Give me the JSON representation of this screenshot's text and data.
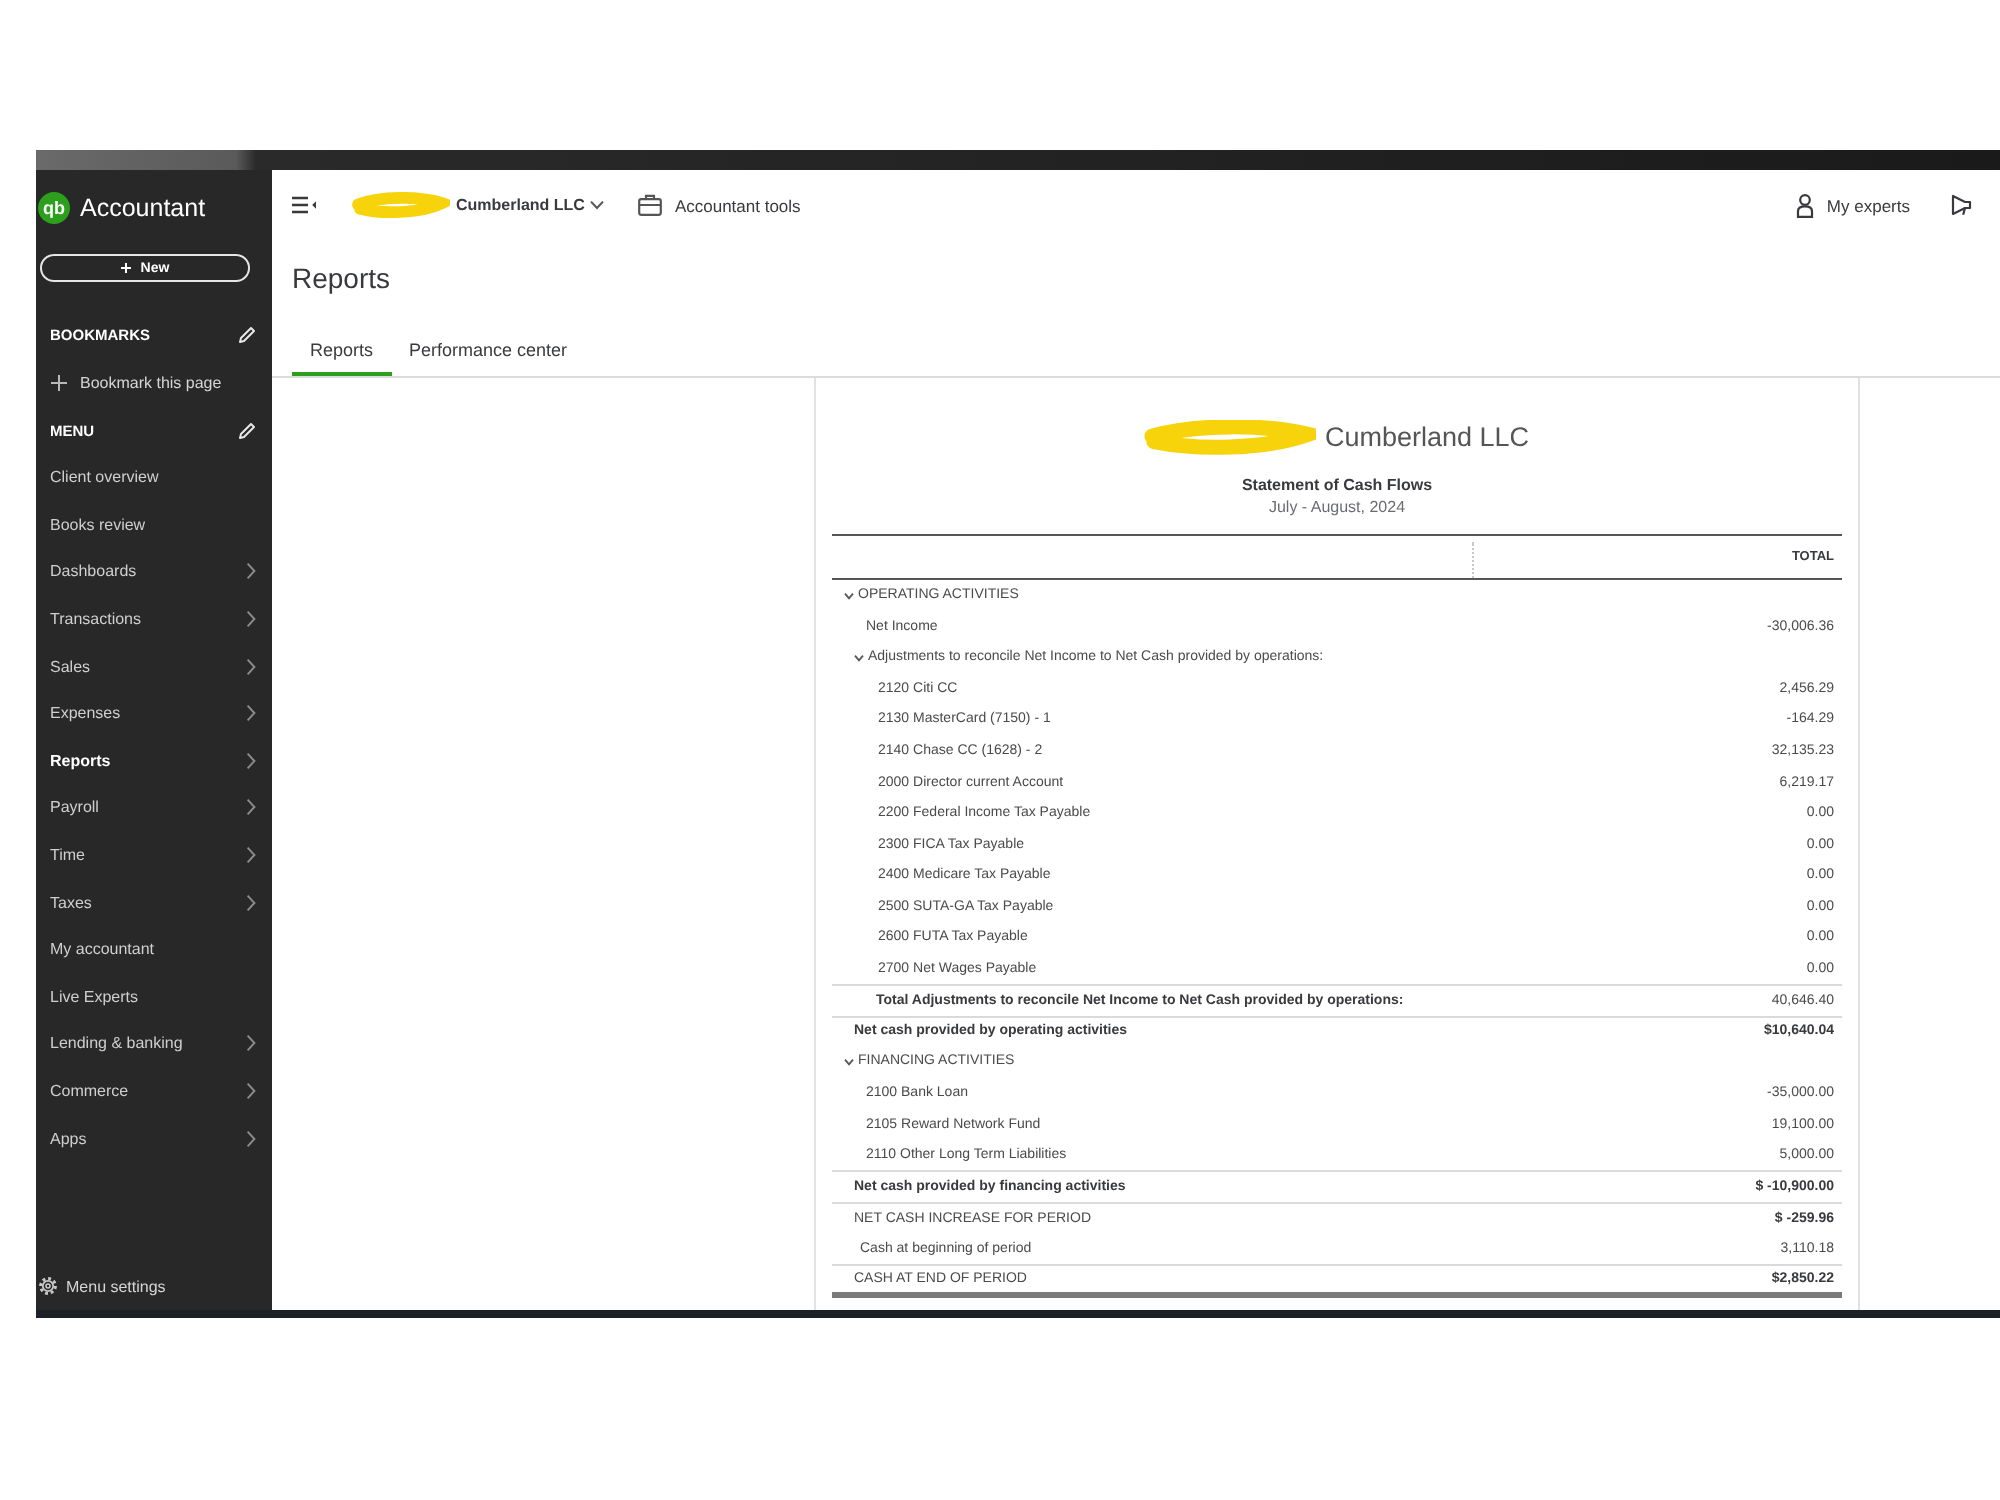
{
  "sidebar": {
    "logo": "qb",
    "product": "Accountant",
    "new_button": "New",
    "bookmarks": {
      "heading": "BOOKMARKS",
      "add_link": "Bookmark this page"
    },
    "menu": {
      "heading": "MENU",
      "items": [
        {
          "label": "Client overview",
          "selected": false,
          "submenu": false
        },
        {
          "label": "Books review",
          "selected": false,
          "submenu": false
        },
        {
          "label": "Dashboards",
          "selected": false,
          "submenu": true
        },
        {
          "label": "Transactions",
          "selected": false,
          "submenu": true
        },
        {
          "label": "Sales",
          "selected": false,
          "submenu": true
        },
        {
          "label": "Expenses",
          "selected": false,
          "submenu": true
        },
        {
          "label": "Reports",
          "selected": true,
          "submenu": true
        },
        {
          "label": "Payroll",
          "selected": false,
          "submenu": true
        },
        {
          "label": "Time",
          "selected": false,
          "submenu": true
        },
        {
          "label": "Taxes",
          "selected": false,
          "submenu": true
        },
        {
          "label": "My accountant",
          "selected": false,
          "submenu": false
        },
        {
          "label": "Live Experts",
          "selected": false,
          "submenu": false
        },
        {
          "label": "Lending & banking",
          "selected": false,
          "submenu": true
        },
        {
          "label": "Commerce",
          "selected": false,
          "submenu": true
        },
        {
          "label": "Apps",
          "selected": false,
          "submenu": true
        }
      ]
    },
    "settings": "Menu settings"
  },
  "header": {
    "company": "Cumberland LLC",
    "tools": "Accountant tools",
    "experts": "My experts"
  },
  "page": {
    "title": "Reports",
    "tabs": [
      {
        "label": "Reports",
        "selected": true
      },
      {
        "label": "Performance center",
        "selected": false
      }
    ]
  },
  "report": {
    "company": "Cumberland LLC",
    "title": "Statement of Cash Flows",
    "period": "July - August, 2024",
    "columns": [
      "TOTAL"
    ],
    "rows": [
      {
        "kind": "section",
        "label": "OPERATING ACTIVITIES",
        "expanded": true,
        "children": [
          {
            "kind": "line",
            "label": "Net Income",
            "value": "-30,006.36"
          },
          {
            "kind": "section",
            "label": "Adjustments to reconcile Net Income to Net Cash provided by operations:",
            "expanded": true,
            "children": [
              {
                "kind": "line",
                "label": "2120 Citi CC",
                "value": "2,456.29"
              },
              {
                "kind": "line",
                "label": "2130 MasterCard (7150) - 1",
                "value": "-164.29"
              },
              {
                "kind": "line",
                "label": "2140 Chase CC (1628) - 2",
                "value": "32,135.23"
              },
              {
                "kind": "line",
                "label": "2000 Director current Account",
                "value": "6,219.17"
              },
              {
                "kind": "line",
                "label": "2200 Federal Income Tax Payable",
                "value": "0.00"
              },
              {
                "kind": "line",
                "label": "2300 FICA Tax Payable",
                "value": "0.00"
              },
              {
                "kind": "line",
                "label": "2400 Medicare Tax Payable",
                "value": "0.00"
              },
              {
                "kind": "line",
                "label": "2500 SUTA-GA Tax Payable",
                "value": "0.00"
              },
              {
                "kind": "line",
                "label": "2600 FUTA Tax Payable",
                "value": "0.00"
              },
              {
                "kind": "line",
                "label": "2700 Net Wages Payable",
                "value": "0.00"
              }
            ],
            "total": {
              "label": "Total Adjustments to reconcile Net Income to Net Cash provided by operations:",
              "value": "40,646.40"
            }
          }
        ],
        "total": {
          "label": "Net cash provided by operating activities",
          "value": "$10,640.04"
        }
      },
      {
        "kind": "section",
        "label": "FINANCING ACTIVITIES",
        "expanded": true,
        "children": [
          {
            "kind": "line",
            "label": "2100 Bank Loan",
            "value": "-35,000.00"
          },
          {
            "kind": "line",
            "label": "2105 Reward Network Fund",
            "value": "19,100.00"
          },
          {
            "kind": "line",
            "label": "2110 Other Long Term Liabilities",
            "value": "5,000.00"
          }
        ],
        "total": {
          "label": "Net cash provided by financing activities",
          "value": "$ -10,900.00"
        }
      },
      {
        "kind": "summary",
        "label": "NET CASH INCREASE FOR PERIOD",
        "value": "$ -259.96"
      },
      {
        "kind": "line",
        "label": "Cash at beginning of period",
        "value": "3,110.18"
      },
      {
        "kind": "grand_total",
        "label": "CASH AT END OF PERIOD",
        "value": "$2,850.22"
      }
    ]
  }
}
